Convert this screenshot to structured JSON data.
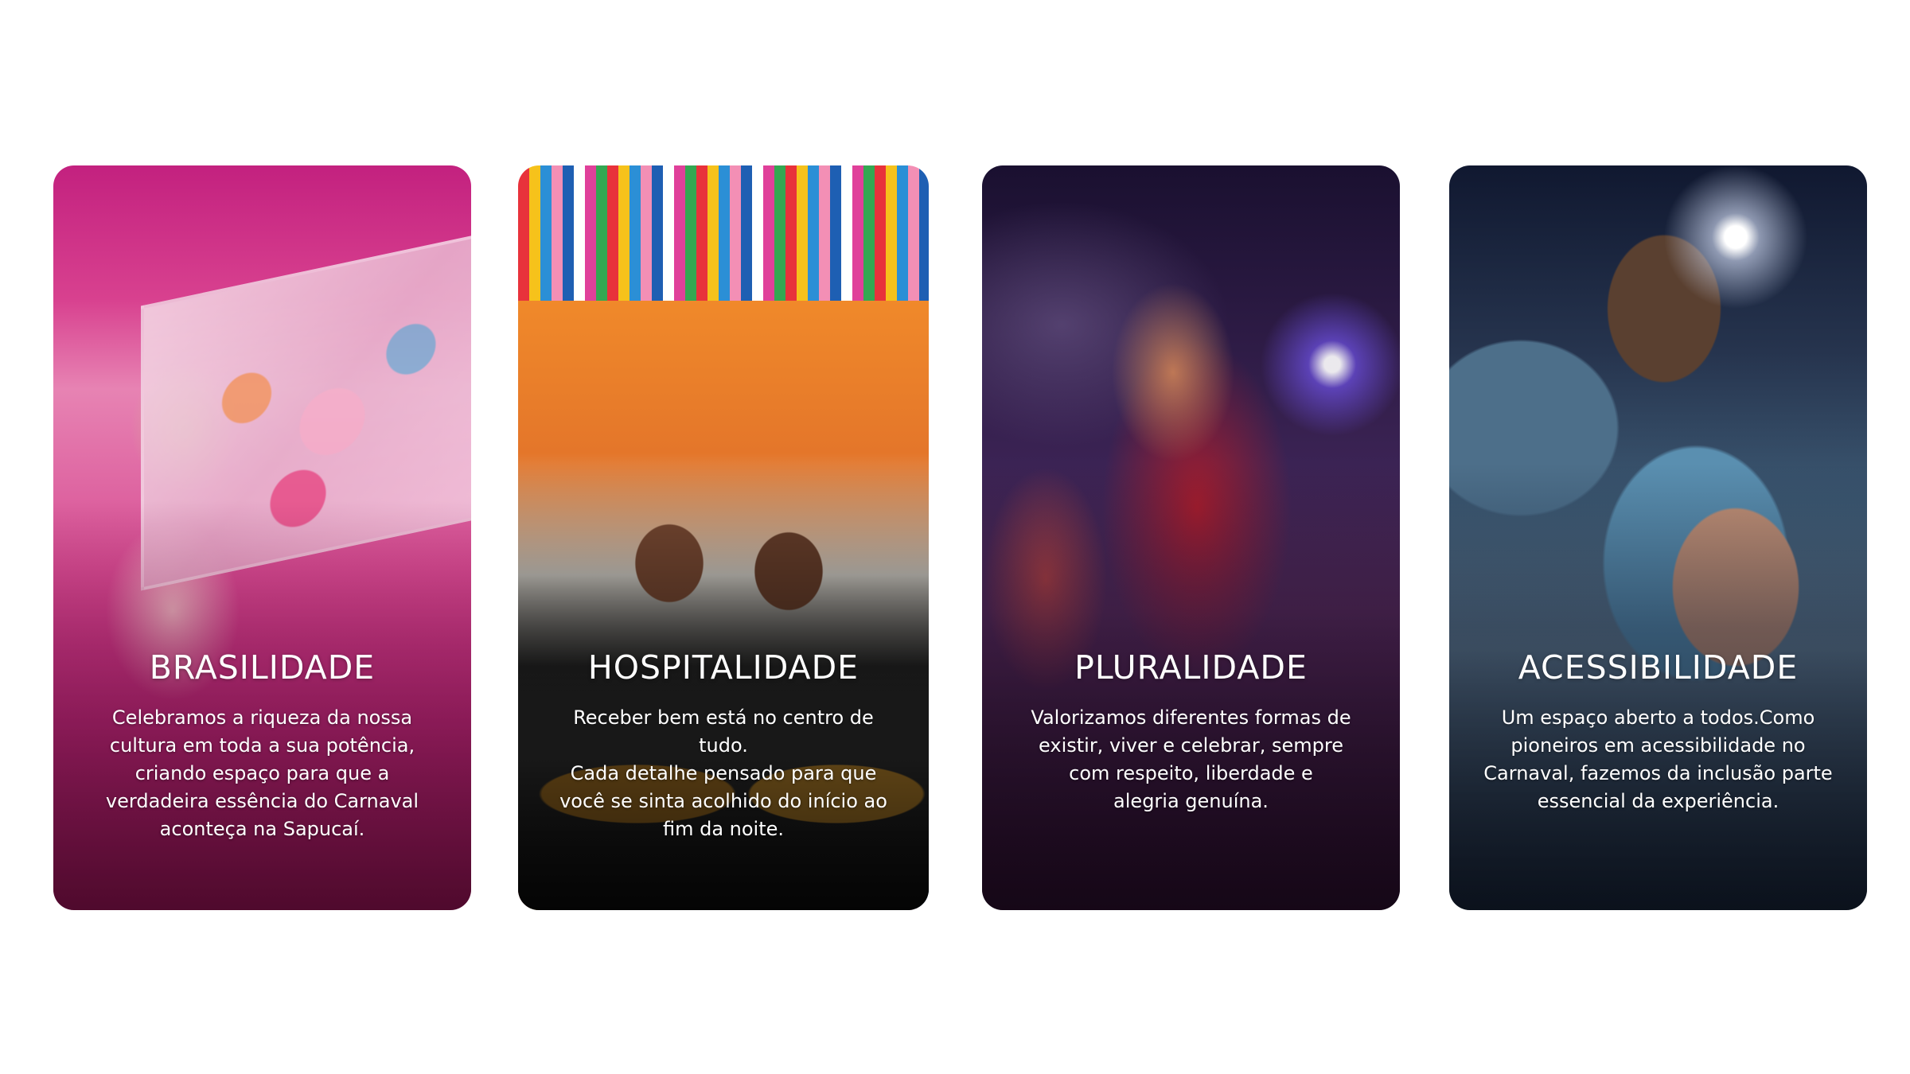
{
  "cards": [
    {
      "title": "BRASILIDADE",
      "description": "Celebramos a riqueza da nossa\ncultura em toda a sua potência,\ncriando espaço para que a\nverdadeira essência do Carnaval\naconteça na Sapucaí.",
      "image": "woman-in-pink-gallery-photo"
    },
    {
      "title": "HOSPITALIDADE",
      "description": "Receber bem está no centro de tudo.\nCada detalhe pensado para que\nvocê se sinta acolhido do início ao\nfim da noite.",
      "image": "kitchen-staff-under-ribbons-photo"
    },
    {
      "title": "PLURALIDADE",
      "description": "Valorizamos diferentes formas de\nexistir, viver e celebrar, sempre\ncom respeito, liberdade e\nalegria genuína.",
      "image": "beaded-performer-night-photo"
    },
    {
      "title": "ACESSIBILIDADE",
      "description": "Um espaço aberto a todos.Como\npioneiros em acessibilidade no\nCarnaval, fazemos da inclusão  parte\nessencial da experiência.",
      "image": "man-in-stadium-photo"
    }
  ]
}
